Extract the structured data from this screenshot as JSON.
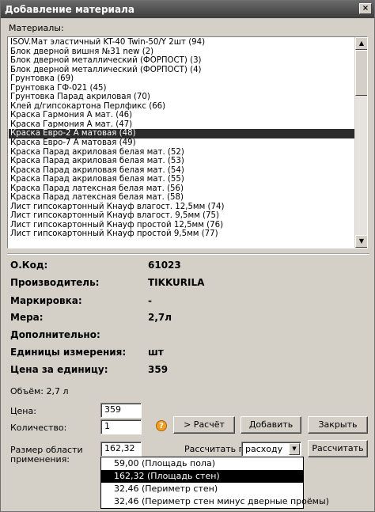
{
  "window": {
    "title": "Добавление материала",
    "close_label": "×"
  },
  "materials": {
    "label": "Материалы:",
    "items": [
      "ISOV.Мат эластичный KT-40 Twin-50/Y 2шт (94)",
      "Блок дверной вишня №31 new (2)",
      "Блок дверной металлический (ФОРПОСТ) (3)",
      "Блок дверной металлический (ФОРПОСТ) (4)",
      "Грунтовка (69)",
      "Грунтовка ГФ-021 (45)",
      "Грунтовка Парад акриловая (70)",
      "Клей д/гипсокартона Перлфикс (66)",
      "Краска Гармония А мат. (46)",
      "Краска Гармония А мат. (47)",
      "Краска Евро-2 А матовая (48)",
      "Краска Евро-7 А матовая (49)",
      "Краска Парад акриловая белая мат. (52)",
      "Краска Парад акриловая белая мат. (53)",
      "Краска Парад акриловая белая мат. (54)",
      "Краска Парад акриловая белая мат. (55)",
      "Краска Парад латексная белая мат. (56)",
      "Краска Парад латексная белая мат. (58)",
      "Лист гипсокартонный Кнауф влагост. 12,5мм (74)",
      "Лист гипсокартонный Кнауф влагост. 9,5мм (75)",
      "Лист гипсокартонный Кнауф простой 12,5мм (76)",
      "Лист гипсокартонный Кнауф простой 9,5мм (77)"
    ],
    "selected_index": 10
  },
  "props": {
    "code_label": "О.Код:",
    "code_value": "61023",
    "maker_label": "Производитель:",
    "maker_value": "TIKKURILA",
    "marking_label": "Маркировка:",
    "marking_value": "-",
    "measure_label": "Мера:",
    "measure_value": "2,7л",
    "extra_label": "Дополнительно:",
    "unit_label": "Единицы измерения:",
    "unit_value": "шт",
    "price_label": "Цена за единицу:",
    "price_value": "359"
  },
  "form": {
    "volume_text": "Объём: 2,7 л",
    "price_label": "Цена:",
    "price_value": "359",
    "qty_label": "Количество:",
    "qty_value": "1",
    "help_glyph": "?",
    "calc_button": "> Расчёт",
    "add_button": "Добавить",
    "close_button": "Закрыть",
    "area_label_1": "Размер области",
    "area_label_2": "применения:",
    "area_value": "162,32",
    "calc_by_label": "Рассчитать по",
    "calc_by_value": "расходу",
    "calc_button2": "Рассчитать",
    "dropdown_arrow": "▼"
  },
  "dropdown": {
    "items": [
      "59,00 (Площадь пола)",
      "162,32 (Площадь стен)",
      "32,46 (Периметр стен)",
      "32,46 (Периметр стен минус дверные проёмы)"
    ],
    "selected_index": 1
  },
  "scroll": {
    "up_glyph": "▲",
    "down_glyph": "▼"
  }
}
